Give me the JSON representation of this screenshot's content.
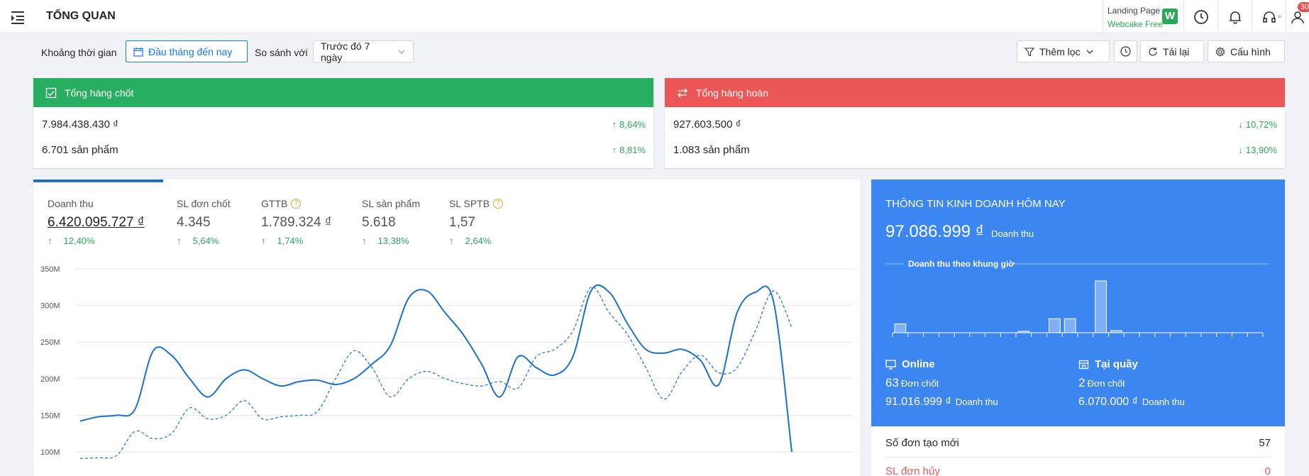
{
  "header": {
    "title": "TỔNG QUAN",
    "landing_line1": "Landing Page",
    "landing_line2": "Webcake Free",
    "logo_letter": "W",
    "notification_badge": "30"
  },
  "filters": {
    "period_label": "Khoảng thời gian",
    "period_value": "Đầu tháng đến nay",
    "compare_label": "So sánh với",
    "compare_value": "Trước đó 7 ngày",
    "more_filter": "Thêm lọc",
    "reload": "Tải lại",
    "config": "Cấu hình"
  },
  "summary": {
    "closed": {
      "title": "Tổng hàng chốt",
      "color": "#27ae60",
      "amount": "7.984.438.430 ₫",
      "amount_change": "8,64%",
      "products": "6.701 sản phẩm",
      "products_change": "8,81%"
    },
    "returned": {
      "title": "Tổng hàng hoàn",
      "color": "#eb5757",
      "amount": "927.603.500 ₫",
      "amount_change": "10,72%",
      "products": "1.083 sản phẩm",
      "products_change": "13,90%"
    }
  },
  "metrics": [
    {
      "label": "Doanh thu",
      "value": "6.420.095.727 ₫",
      "change": "12,40%",
      "help": false
    },
    {
      "label": "SL đơn chốt",
      "value": "4.345",
      "change": "5,64%",
      "help": false
    },
    {
      "label": "GTTB",
      "value": "1.789.324 ₫",
      "change": "1,74%",
      "help": true
    },
    {
      "label": "SL sản phẩm",
      "value": "5.618",
      "change": "13,38%",
      "help": false
    },
    {
      "label": "SL SPTB",
      "value": "1,57",
      "change": "2,64%",
      "help": true
    }
  ],
  "chart_data": {
    "type": "line",
    "title": "",
    "y_ticks": [
      "350M",
      "300M",
      "250M",
      "200M",
      "150M",
      "100M"
    ],
    "ylim": [
      100,
      350
    ],
    "y_unit": "M",
    "grid": true,
    "series": [
      {
        "style": "solid",
        "color": "#1a6fcf",
        "values": [
          142,
          148,
          150,
          158,
          238,
          232,
          200,
          175,
          200,
          212,
          200,
          190,
          196,
          198,
          192,
          200,
          220,
          245,
          310,
          320,
          290,
          260,
          220,
          175,
          230,
          215,
          205,
          230,
          320,
          318,
          275,
          240,
          235,
          240,
          225,
          192,
          290,
          318,
          305,
          100
        ]
      },
      {
        "style": "dashed",
        "color": "#1a6fcf",
        "values": [
          91,
          92,
          95,
          128,
          118,
          125,
          160,
          145,
          150,
          170,
          145,
          148,
          150,
          155,
          200,
          238,
          215,
          175,
          200,
          210,
          200,
          193,
          190,
          196,
          187,
          230,
          240,
          265,
          325,
          290,
          260,
          215,
          172,
          210,
          232,
          208,
          215,
          265,
          320,
          270
        ]
      }
    ]
  },
  "side": {
    "title": "THÔNG TIN KINH DOANH HÔM NAY",
    "revenue": "97.086.999 ₫",
    "revenue_label": "Doanh thu",
    "hourly_title": "Doanh thu theo khung giờ",
    "hourly_chart": {
      "type": "bar",
      "values": [
        0.17,
        0,
        0,
        0,
        0,
        0,
        0,
        0,
        0.02,
        0,
        0.27,
        0.27,
        0,
        1.0,
        0.04,
        0,
        0,
        0,
        0,
        0,
        0,
        0,
        0,
        0
      ]
    },
    "online": {
      "title": "Online",
      "orders": "63",
      "orders_label": "Đơn chốt",
      "revenue": "91.016.999 ₫",
      "revenue_label": "Doanh thu"
    },
    "counter": {
      "title": "Tại quầy",
      "orders": "2",
      "orders_label": "Đơn chốt",
      "revenue": "6.070.000 ₫",
      "revenue_label": "Doanh thu"
    },
    "new_orders_label": "Số đơn tạo mới",
    "new_orders_value": "57",
    "cancel_label": "SL đơn hủy",
    "cancel_value": "0"
  }
}
